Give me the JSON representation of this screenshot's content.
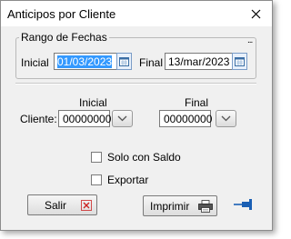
{
  "window": {
    "title": "Anticipos por Cliente"
  },
  "icons": {
    "close": "close-icon",
    "calendar": "calendar-icon",
    "dropdown": "chevron-down-icon",
    "exit": "x-icon",
    "print": "printer-icon",
    "pin": "pin-icon",
    "more": "ellipsis-icon"
  },
  "date_range": {
    "legend": "Rango de Fechas",
    "initial_label": "Inicial",
    "initial_value": "01/03/2023",
    "final_label": "Final",
    "final_value": "13/mar/2023",
    "more": "..."
  },
  "client_range": {
    "label": "Cliente:",
    "initial_header": "Inicial",
    "final_header": "Final",
    "initial_value": "00000000",
    "final_value": "00000000"
  },
  "options": {
    "solo_con_saldo": "Solo con Saldo",
    "exportar": "Exportar"
  },
  "buttons": {
    "exit": "Salir",
    "print": "Imprimir"
  },
  "colors": {
    "selection": "#3399ff",
    "exit_icon": "#cc2222",
    "pin": "#1a5fb4"
  }
}
